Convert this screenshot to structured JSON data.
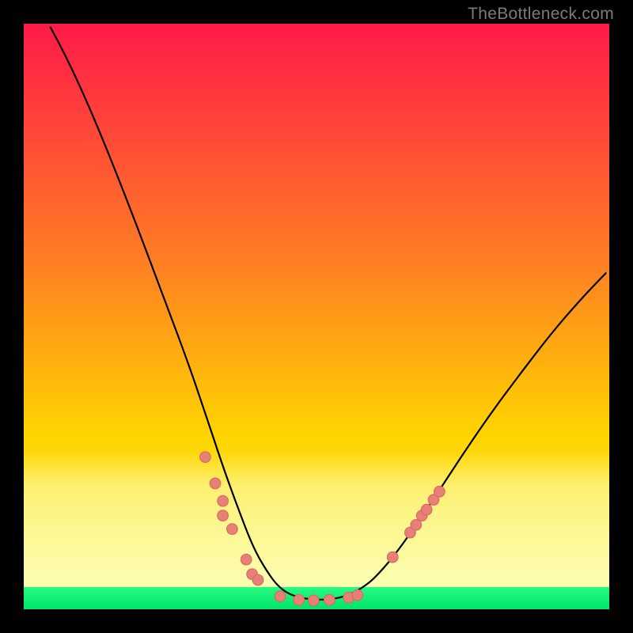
{
  "watermark": "TheBottleneck.com",
  "colors": {
    "dot_fill": "#e78076",
    "dot_stroke": "#d96a60",
    "curve_stroke": "#000000",
    "green_band_top": "#28fa82",
    "green_band_bottom": "#00e569",
    "yellow_band": "#fbffb8",
    "grad_top": "#ff1a49",
    "grad_mid1": "#ff7d24",
    "grad_mid2": "#ffd400",
    "grad_bot": "#fff04a"
  },
  "chart_data": {
    "type": "line",
    "x_range": [
      0,
      100
    ],
    "y_range": [
      0,
      100
    ],
    "note": "Screenshot has no axis ticks/labels; x and y are normalized 0-100 (y = 0 means bottom / minimum bottleneck).",
    "series": [
      {
        "name": "bottleneck-curve",
        "points": [
          {
            "x": 4.5,
            "y": 99.5
          },
          {
            "x": 7.0,
            "y": 95.0
          },
          {
            "x": 12.0,
            "y": 84.0
          },
          {
            "x": 18.0,
            "y": 69.0
          },
          {
            "x": 24.0,
            "y": 53.0
          },
          {
            "x": 28.0,
            "y": 42.3
          },
          {
            "x": 31.0,
            "y": 33.5
          },
          {
            "x": 33.8,
            "y": 25.0
          },
          {
            "x": 36.5,
            "y": 17.5
          },
          {
            "x": 39.2,
            "y": 10.5
          },
          {
            "x": 41.5,
            "y": 6.5
          },
          {
            "x": 43.5,
            "y": 3.8
          },
          {
            "x": 46.0,
            "y": 2.2
          },
          {
            "x": 49.5,
            "y": 1.6
          },
          {
            "x": 53.0,
            "y": 1.7
          },
          {
            "x": 56.0,
            "y": 2.6
          },
          {
            "x": 58.3,
            "y": 4.0
          },
          {
            "x": 60.0,
            "y": 5.4
          },
          {
            "x": 63.0,
            "y": 8.8
          },
          {
            "x": 66.5,
            "y": 13.6
          },
          {
            "x": 70.0,
            "y": 18.8
          },
          {
            "x": 75.0,
            "y": 26.5
          },
          {
            "x": 80.0,
            "y": 33.8
          },
          {
            "x": 85.0,
            "y": 40.5
          },
          {
            "x": 90.0,
            "y": 47.0
          },
          {
            "x": 95.0,
            "y": 52.8
          },
          {
            "x": 99.5,
            "y": 57.5
          }
        ]
      }
    ],
    "markers": [
      {
        "x": 31.0,
        "y": 26.0
      },
      {
        "x": 32.7,
        "y": 21.5
      },
      {
        "x": 34.0,
        "y": 18.5
      },
      {
        "x": 34.0,
        "y": 16.0
      },
      {
        "x": 35.6,
        "y": 13.7
      },
      {
        "x": 38.0,
        "y": 8.5
      },
      {
        "x": 39.0,
        "y": 6.0
      },
      {
        "x": 40.0,
        "y": 5.0
      },
      {
        "x": 43.8,
        "y": 2.2
      },
      {
        "x": 47.0,
        "y": 1.6
      },
      {
        "x": 49.5,
        "y": 1.5
      },
      {
        "x": 52.2,
        "y": 1.6
      },
      {
        "x": 55.5,
        "y": 2.0
      },
      {
        "x": 57.0,
        "y": 2.4
      },
      {
        "x": 63.0,
        "y": 8.9
      },
      {
        "x": 66.0,
        "y": 13.1
      },
      {
        "x": 67.0,
        "y": 14.4
      },
      {
        "x": 68.0,
        "y": 16.0
      },
      {
        "x": 68.8,
        "y": 17.0
      },
      {
        "x": 70.0,
        "y": 18.7
      },
      {
        "x": 71.0,
        "y": 20.1
      }
    ],
    "green_band_y": [
      0,
      3.8
    ],
    "yellow_band_y": [
      3.8,
      27.0
    ]
  }
}
